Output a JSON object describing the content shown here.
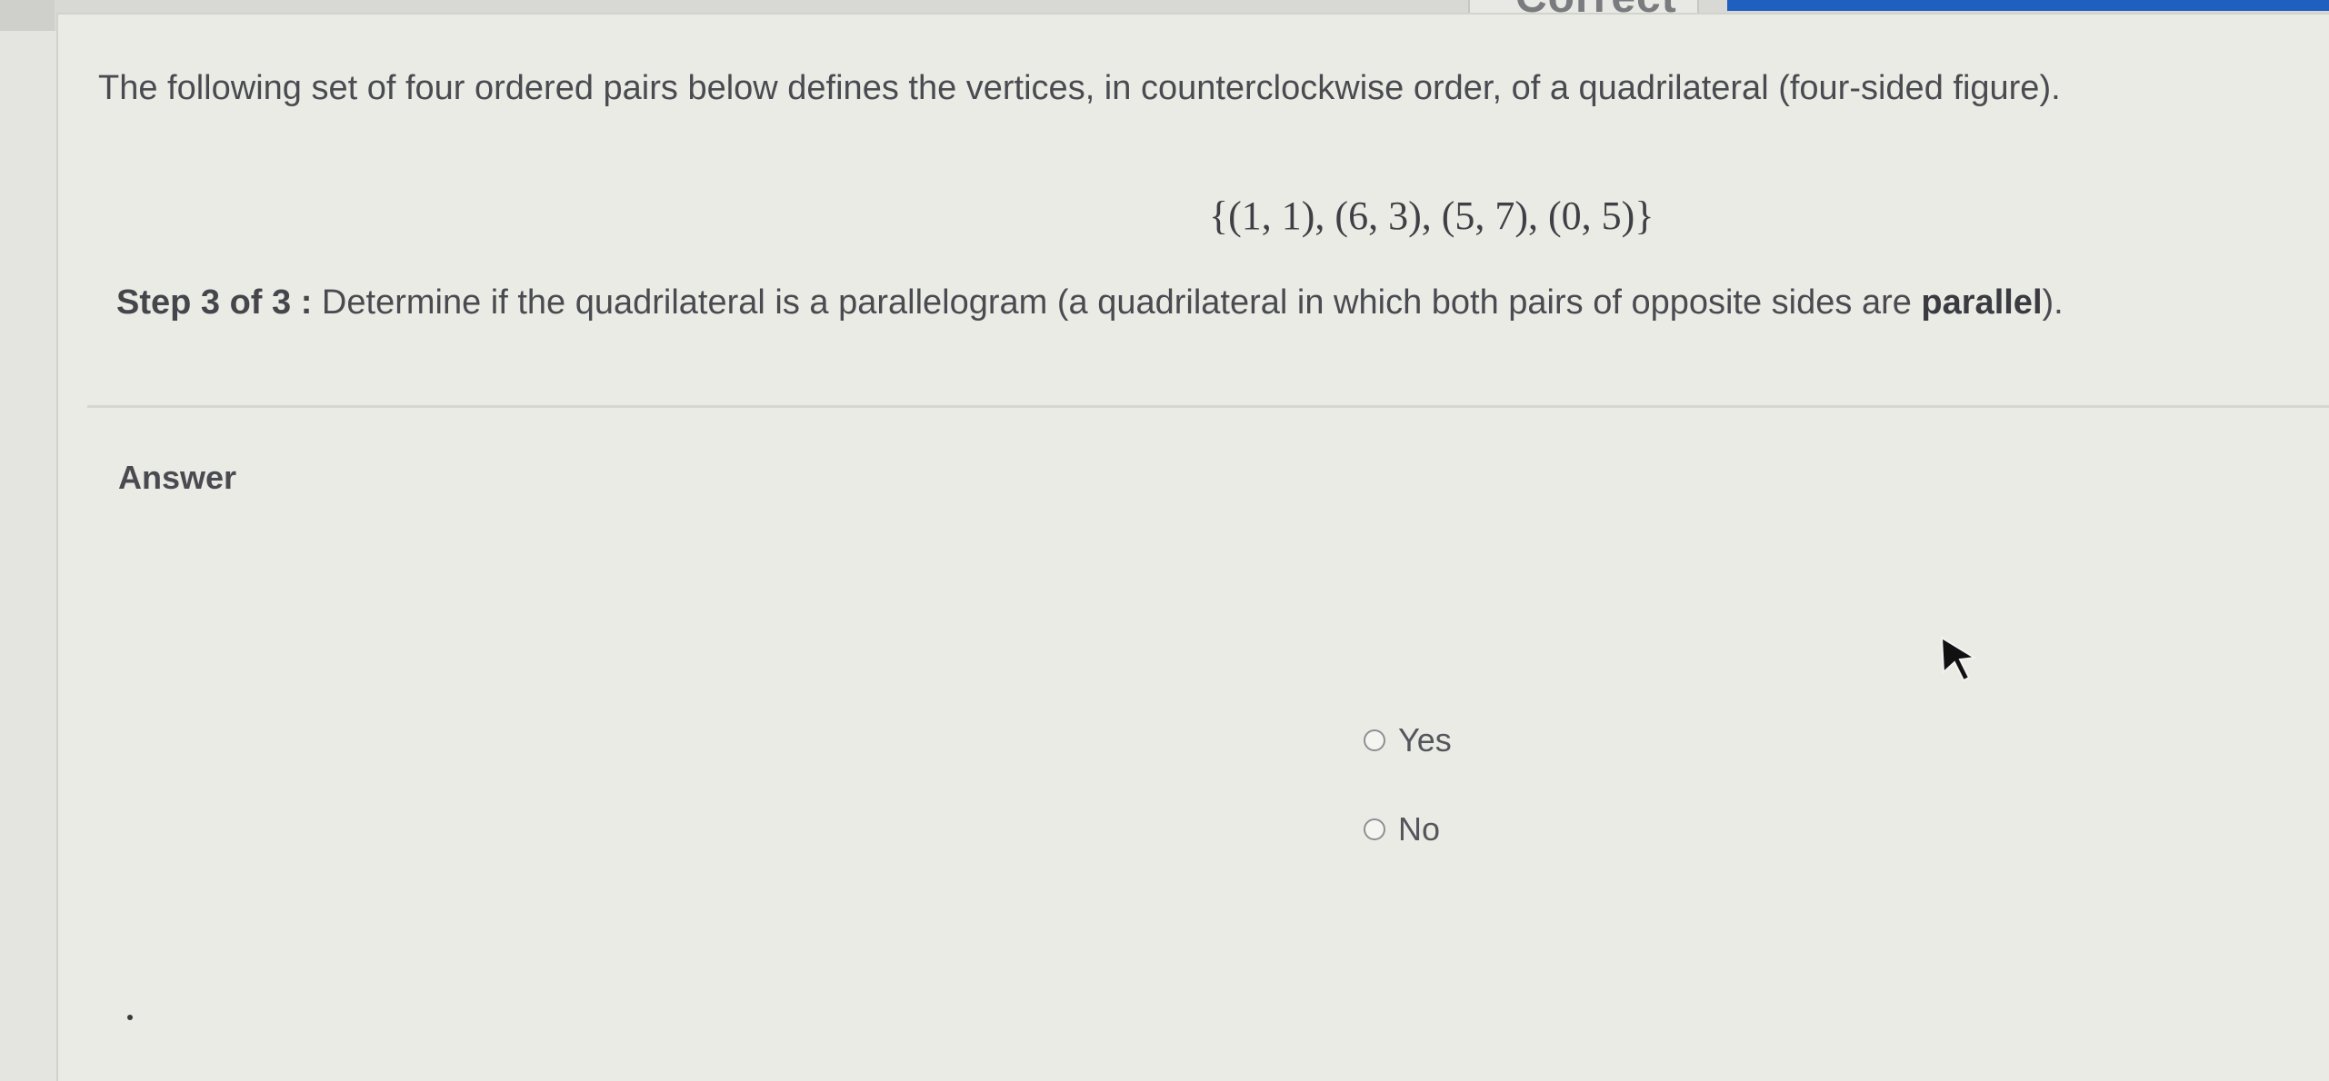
{
  "header": {
    "status_tab": "Correct"
  },
  "question": {
    "prompt": "The following set of four ordered pairs below defines the vertices, in counterclockwise order, of a quadrilateral (four-sided figure).",
    "vertices": "{(1, 1), (6, 3), (5, 7), (0, 5)}",
    "step_label": "Step 3 of 3 :",
    "step_text_before": " Determine if the quadrilateral is a parallelogram (a quadrilateral in which both pairs of opposite sides are ",
    "step_text_bold": "parallel",
    "step_text_after": ")."
  },
  "answer": {
    "label": "Answer",
    "options": [
      {
        "label": "Yes",
        "selected": false
      },
      {
        "label": "No",
        "selected": false
      }
    ]
  },
  "colors": {
    "accent_blue": "#1f5fc0",
    "panel_bg": "#ebebe6",
    "text": "#4a4b50"
  }
}
